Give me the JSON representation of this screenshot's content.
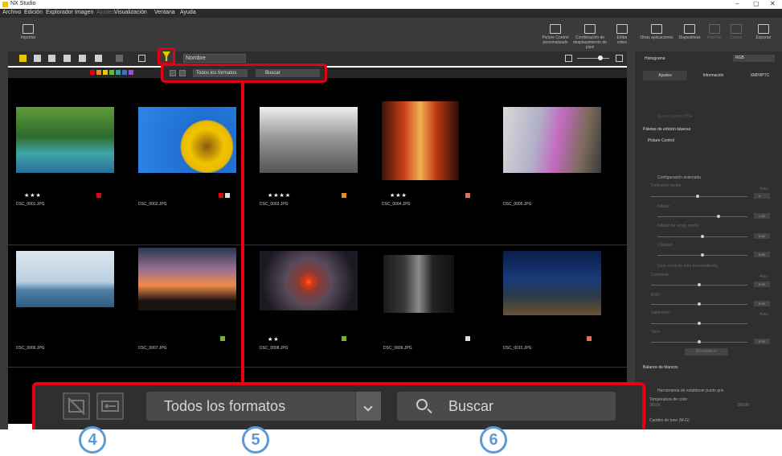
{
  "window": {
    "title": "NX Studio",
    "controls": [
      "–",
      "▢",
      "✕"
    ]
  },
  "menu": [
    {
      "label": "Archivo",
      "enabled": true
    },
    {
      "label": "Edición",
      "enabled": true
    },
    {
      "label": "Explorador",
      "enabled": true
    },
    {
      "label": "Imagen",
      "enabled": true
    },
    {
      "label": "Ajustes",
      "enabled": false
    },
    {
      "label": "Visualización",
      "enabled": true
    },
    {
      "label": "Ventana",
      "enabled": true
    },
    {
      "label": "Ayuda",
      "enabled": true
    }
  ],
  "toolbar": {
    "import": "Importar",
    "picture_control": "Picture Control personalizado",
    "pixel_shift": "Combinación de desplazamiento de píxel",
    "edit_video": "Editar vídeo",
    "other_apps": "Otras aplicaciones",
    "slideshow": "Diapositivas",
    "print": "Imprimir",
    "upload": "Cargar",
    "export": "Exportar"
  },
  "sort": {
    "selected": "Nombre"
  },
  "filter_bar": {
    "formats": "Todos los formatos",
    "search_placeholder": "Buscar"
  },
  "thumbnails": [
    {
      "name": "DSC_0001.JPG",
      "rating": "★★★",
      "label_color": "#e60012",
      "label_num": "1"
    },
    {
      "name": "DSC_0002.JPG",
      "rating": "",
      "label_color": "#e60012",
      "label_num": "1"
    },
    {
      "name": "DSC_0003.JPG",
      "rating": "★★★★",
      "label_color": "#f08a24",
      "label_num": "2"
    },
    {
      "name": "DSC_0004.JPG",
      "rating": "★★★",
      "label_color": "#e8705a",
      "label_num": "3"
    },
    {
      "name": "DSC_0005.JPG",
      "rating": "",
      "label_color": "",
      "label_num": ""
    },
    {
      "name": "DSC_0006.JPG",
      "rating": "",
      "label_color": "",
      "label_num": ""
    },
    {
      "name": "DSC_0007.JPG",
      "rating": "",
      "label_color": "#6dbb2b",
      "label_num": "6"
    },
    {
      "name": "DSC_0008.JPG",
      "rating": "★★",
      "label_color": "#6dbb2b",
      "label_num": "6"
    },
    {
      "name": "DSC_0009.JPG",
      "rating": "",
      "label_color": "",
      "label_num": ""
    },
    {
      "name": "DSC_0010.JPG",
      "rating": "",
      "label_color": "#e8705a",
      "label_num": "3"
    }
  ],
  "right_panel": {
    "histogram": "Histograma",
    "histogram_mode": "RGB",
    "tabs": [
      "Ajustes",
      "Información",
      "XMP/IPTC"
    ],
    "hdr": "Ajuste usando HDR",
    "basic": "Paletas de edición básicas",
    "picture_control": "Picture Control",
    "advanced": "Configuración avanzada",
    "quick_sharp": "Definición rápida",
    "auto": "Auto",
    "sharpening": "Nitidez",
    "midrange": "Nitidez de rango medio",
    "clarity": "Claridad",
    "custom_curve": "Usar curva de tono personalizada",
    "contrast": "Contraste",
    "brightness": "Brillo",
    "saturation": "Saturación",
    "hue": "Tono",
    "reset": "Restablecer",
    "wb": "Balance de blancos",
    "wb_tool": "Herramienta de establecer punto gris",
    "temp": "Temperatura de color",
    "temp_min": "2810K",
    "temp_max": "8560K",
    "tint": "Cambio de tono (M-G)",
    "values": [
      "0",
      "1.00",
      "0.00",
      "0.00",
      "0.00",
      "0.00",
      "0.00"
    ]
  },
  "callout_badges": [
    "4",
    "5",
    "6"
  ]
}
